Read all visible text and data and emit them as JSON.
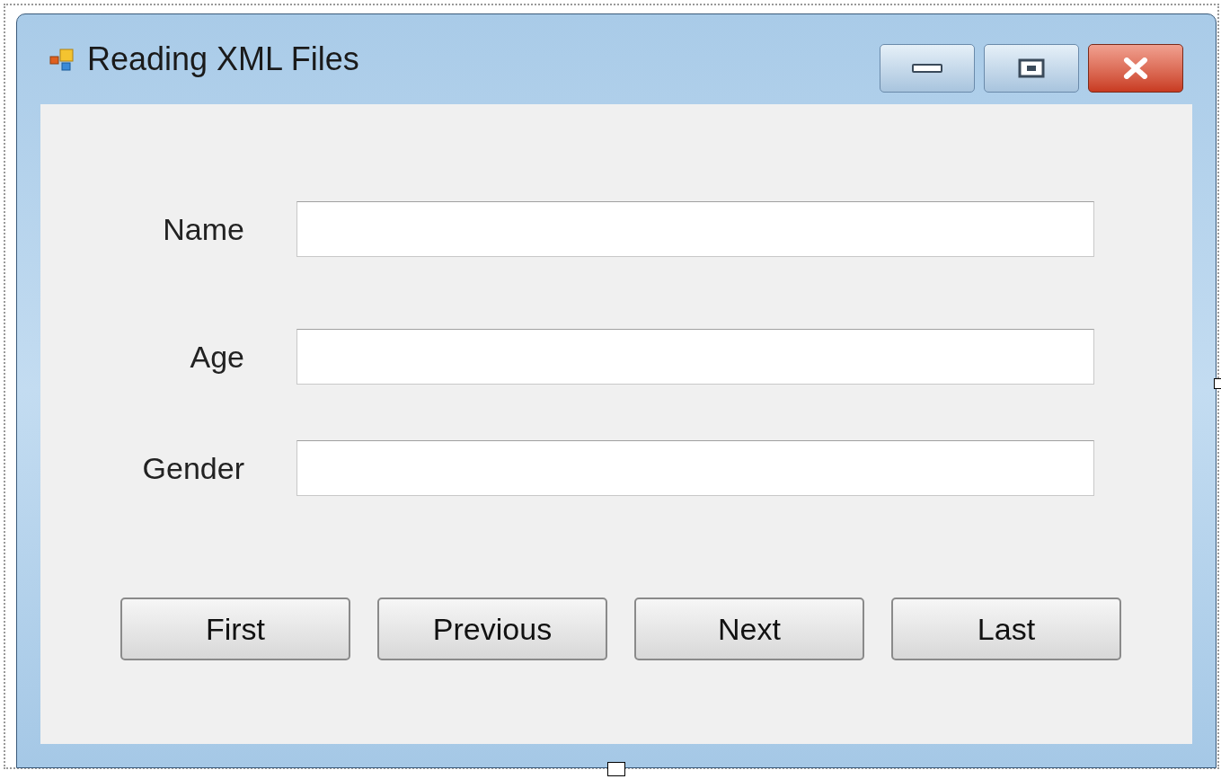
{
  "window": {
    "title": "Reading XML Files"
  },
  "fields": [
    {
      "label": "Name"
    },
    {
      "label": "Age"
    },
    {
      "label": "Gender"
    }
  ],
  "buttons": [
    "First",
    "Previous",
    "Next",
    "Last"
  ]
}
